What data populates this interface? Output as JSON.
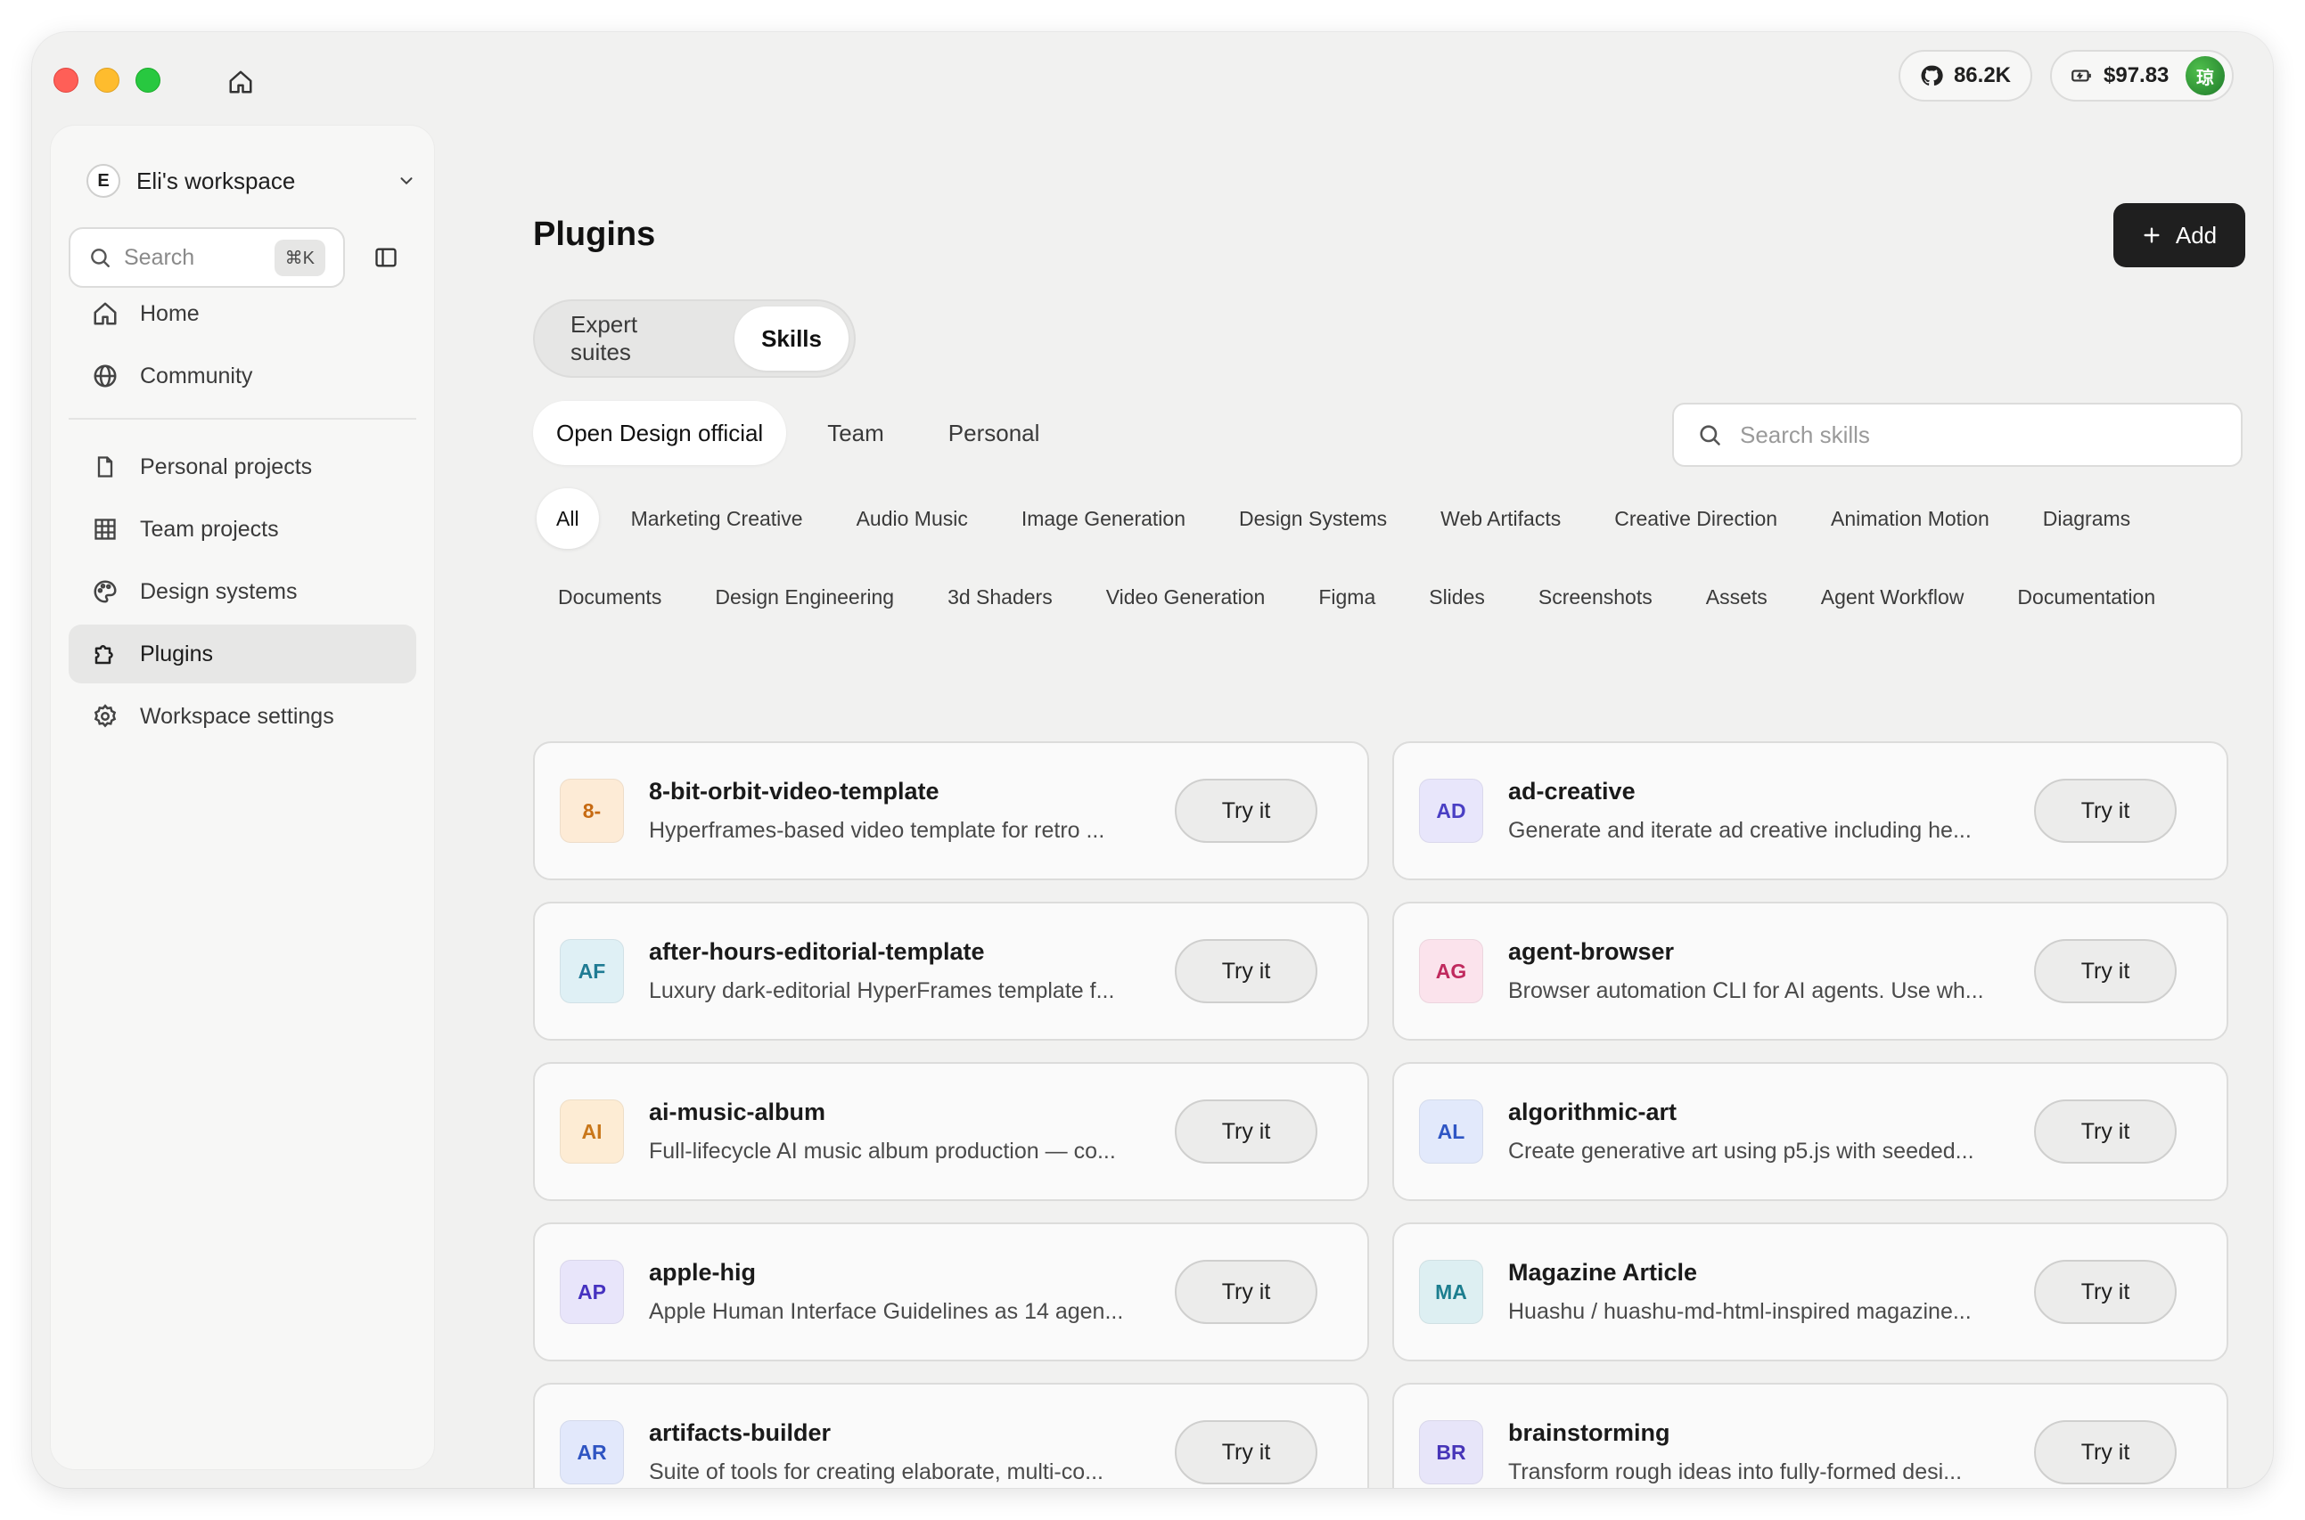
{
  "topbar": {
    "github_stars": "86.2K",
    "credit": "$97.83",
    "avatar_char": "琼"
  },
  "sidebar": {
    "workspace_initial": "E",
    "workspace_name": "Eli's workspace",
    "search_placeholder": "Search",
    "search_shortcut": "⌘K",
    "primary": [
      {
        "label": "Home",
        "icon": "home-icon"
      },
      {
        "label": "Community",
        "icon": "globe-icon"
      }
    ],
    "secondary": [
      {
        "label": "Personal projects",
        "icon": "file-icon"
      },
      {
        "label": "Team projects",
        "icon": "grid-icon"
      },
      {
        "label": "Design systems",
        "icon": "palette-icon"
      },
      {
        "label": "Plugins",
        "icon": "puzzle-icon",
        "active": true
      },
      {
        "label": "Workspace settings",
        "icon": "gear-icon"
      }
    ]
  },
  "main": {
    "title": "Plugins",
    "add_label": "Add",
    "segments": [
      "Expert suites",
      "Skills"
    ],
    "scopes": [
      "Open Design official",
      "Team",
      "Personal"
    ],
    "search_placeholder": "Search skills",
    "categories": [
      "All",
      "Marketing Creative",
      "Audio Music",
      "Image Generation",
      "Design Systems",
      "Web Artifacts",
      "Creative Direction",
      "Animation Motion",
      "Diagrams",
      "Documents",
      "Design Engineering",
      "3d Shaders",
      "Video Generation",
      "Figma",
      "Slides",
      "Screenshots",
      "Assets",
      "Agent Workflow",
      "Documentation"
    ],
    "try_label": "Try it",
    "cards": [
      {
        "badge": "8-",
        "title": "8-bit-orbit-video-template",
        "desc": "Hyperframes-based video template for retro ..."
      },
      {
        "badge": "AD",
        "title": "ad-creative",
        "desc": "Generate and iterate ad creative including he..."
      },
      {
        "badge": "AF",
        "title": "after-hours-editorial-template",
        "desc": "Luxury dark-editorial HyperFrames template f..."
      },
      {
        "badge": "AG",
        "title": "agent-browser",
        "desc": "Browser automation CLI for AI agents. Use wh..."
      },
      {
        "badge": "AI",
        "title": "ai-music-album",
        "desc": "Full-lifecycle AI music album production — co..."
      },
      {
        "badge": "AL",
        "title": "algorithmic-art",
        "desc": "Create generative art using p5.js with seeded..."
      },
      {
        "badge": "AP",
        "title": "apple-hig",
        "desc": "Apple Human Interface Guidelines as 14 agen..."
      },
      {
        "badge": "MA",
        "title": "Magazine Article",
        "desc": "Huashu / huashu-md-html-inspired magazine..."
      },
      {
        "badge": "AR",
        "title": "artifacts-builder",
        "desc": "Suite of tools for creating elaborate, multi-co..."
      },
      {
        "badge": "BR",
        "title": "brainstorming",
        "desc": "Transform rough ideas into fully-formed desi..."
      }
    ],
    "badge_colors": [
      {
        "bg": "#fdebd6",
        "fg": "#c76a12"
      },
      {
        "bg": "#e8e6fb",
        "fg": "#4a3fc4"
      },
      {
        "bg": "#dff0f5",
        "fg": "#1f7b93"
      },
      {
        "bg": "#fbe3ec",
        "fg": "#c02a5e"
      },
      {
        "bg": "#fdecd4",
        "fg": "#c9771a"
      },
      {
        "bg": "#e2e9fb",
        "fg": "#2f56c4"
      },
      {
        "bg": "#e8e5fa",
        "fg": "#4632c0"
      },
      {
        "bg": "#ddeff2",
        "fg": "#1c7e8f"
      },
      {
        "bg": "#e2e8fb",
        "fg": "#2f54c2"
      },
      {
        "bg": "#e7e5f9",
        "fg": "#4735b8"
      }
    ]
  }
}
